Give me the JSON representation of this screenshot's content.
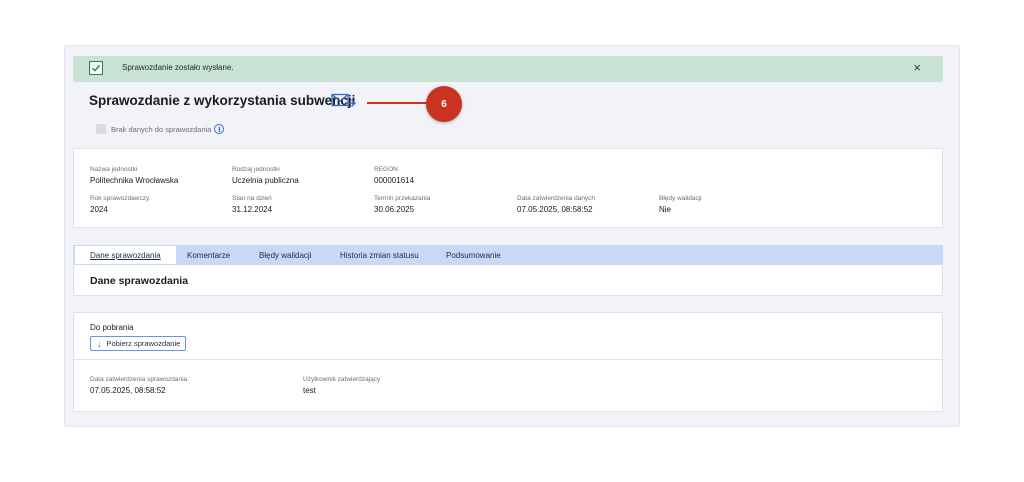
{
  "alert": {
    "message": "Sprawozdanie zostało wysłane.",
    "close_glyph": "×"
  },
  "header": {
    "title": "Sprawozdanie z wykorzystania subwencji",
    "callout_number": "6"
  },
  "nodata": {
    "label": "Brak danych do sprawozdania",
    "info_glyph": "i"
  },
  "details": {
    "unit_name_label": "Nazwa jednostki",
    "unit_name": "Politechnika Wrocławska",
    "unit_type_label": "Rodzaj jednostki",
    "unit_type": "Uczelnia publiczna",
    "regon_label": "REGON",
    "regon": "000001614",
    "year_label": "Rok sprawozdawczy",
    "year": "2024",
    "state_label": "Stan na dzień",
    "state": "31.12.2024",
    "deadline_label": "Termin przekazania",
    "deadline": "30.06.2025",
    "approval_label": "Data zatwierdzenia danych",
    "approval": "07.05.2025, 08:58:52",
    "errors_label": "Błędy walidacji",
    "errors": "Nie"
  },
  "tabs": [
    "Dane sprawozdania",
    "Komentarze",
    "Błędy walidacji",
    "Historia zmian statusu",
    "Podsumowanie"
  ],
  "tab_content": {
    "title": "Dane sprawozdania"
  },
  "download": {
    "label": "Do pobrania",
    "button": "Pobierz sprawozdanie",
    "approval_date_label": "Data zatwierdzenia sprawozdania",
    "approval_date": "07.05.2025, 08:58:52",
    "approver_label": "Użytkownik zatwierdzający",
    "approver": "test"
  },
  "colors": {
    "accent": "#2f67d6",
    "success_bg": "#c8e3d3",
    "tab_bar": "#c7d9f7",
    "callout": "#c9331f"
  }
}
